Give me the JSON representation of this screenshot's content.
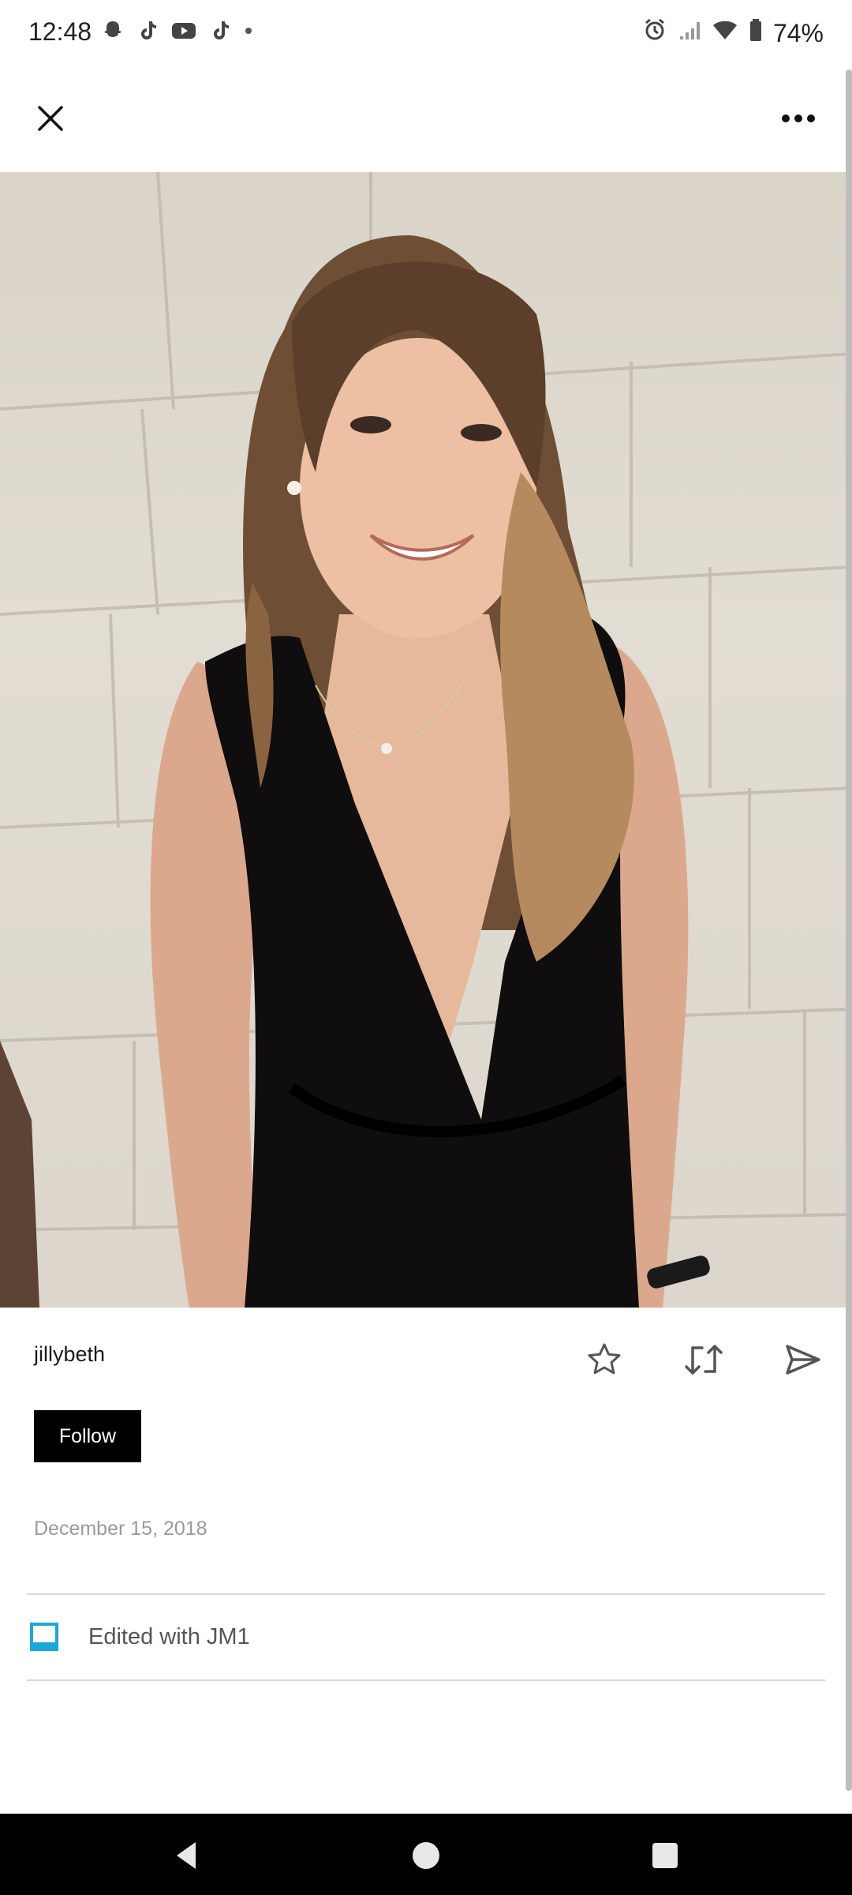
{
  "status_bar": {
    "time": "12:48",
    "app_icons": [
      "snapchat-icon",
      "tiktok-icon",
      "youtube-icon",
      "tiktok-icon",
      "dot-icon"
    ],
    "battery": "74%"
  },
  "top_bar": {
    "close_icon": "close-icon",
    "more_icon": "more-horizontal-icon"
  },
  "post": {
    "username": "jillybeth",
    "follow_label": "Follow",
    "date": "December 15, 2018",
    "edited_label": "Edited with JM1"
  },
  "colors": {
    "follow_bg": "#000000",
    "edited_icon": "#1ba8d6",
    "navbar": "#000000"
  }
}
